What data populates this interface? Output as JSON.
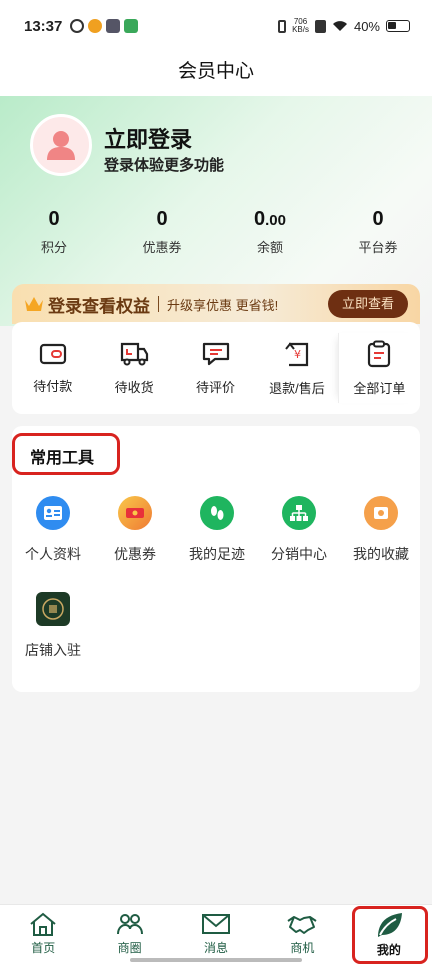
{
  "status_bar": {
    "time": "13:37",
    "net_speed_value": "706",
    "net_speed_unit": "KB/s",
    "battery": "40%"
  },
  "page_title": "会员中心",
  "profile": {
    "login_title": "立即登录",
    "login_subtitle": "登录体验更多功能"
  },
  "stats": [
    {
      "value": "0",
      "label": "积分"
    },
    {
      "value": "0",
      "label": "优惠券"
    },
    {
      "value_int": "0",
      "value_dec": ".00",
      "label": "余额"
    },
    {
      "value": "0",
      "label": "平台券"
    }
  ],
  "vip_banner": {
    "title": "登录查看权益",
    "subtitle": "升级享优惠 更省钱!",
    "button": "立即查看"
  },
  "orders": [
    {
      "label": "待付款",
      "icon": "wallet-icon"
    },
    {
      "label": "待收货",
      "icon": "truck-icon"
    },
    {
      "label": "待评价",
      "icon": "comment-icon"
    },
    {
      "label": "退款/售后",
      "icon": "refund-icon"
    },
    {
      "label": "全部订单",
      "icon": "clipboard-icon"
    }
  ],
  "tools": {
    "title": "常用工具",
    "items": [
      {
        "label": "个人资料",
        "icon": "profile-card-icon",
        "color": "#2f8cf0"
      },
      {
        "label": "优惠券",
        "icon": "coupon-icon",
        "color": "#f5b638"
      },
      {
        "label": "我的足迹",
        "icon": "footprint-icon",
        "color": "#1fb55f"
      },
      {
        "label": "分销中心",
        "icon": "org-chart-icon",
        "color": "#1fb55f"
      },
      {
        "label": "我的收藏",
        "icon": "favorites-icon",
        "color": "#f5a04a"
      },
      {
        "label": "店铺入驻",
        "icon": "store-badge-icon",
        "color": "#1d3a26"
      }
    ]
  },
  "tabbar": {
    "accent_color": "#1f5c43",
    "items": [
      {
        "label": "首页",
        "icon": "home-icon"
      },
      {
        "label": "商圈",
        "icon": "people-icon"
      },
      {
        "label": "消息",
        "icon": "mail-icon"
      },
      {
        "label": "商机",
        "icon": "handshake-icon"
      },
      {
        "label": "我的",
        "icon": "leaf-icon",
        "active": true
      }
    ]
  }
}
